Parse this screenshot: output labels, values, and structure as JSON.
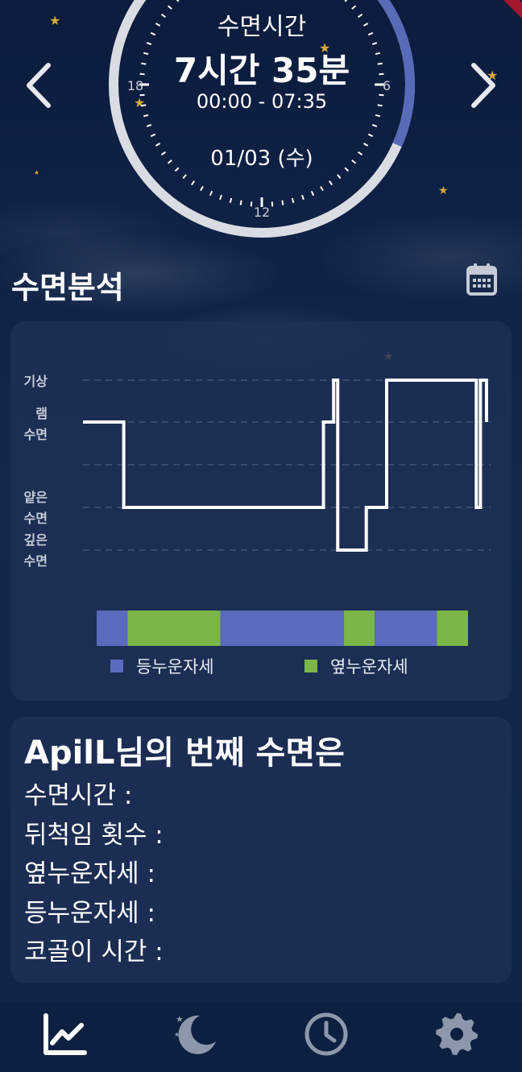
{
  "dial": {
    "title": "수면시간",
    "duration": "7시간 35분",
    "range": "00:00 - 07:35",
    "date": "01/03 (수)",
    "hour_labels": [
      "12",
      "18",
      "6"
    ],
    "accent_color": "#5a69b8",
    "ring_color": "#d9dce3"
  },
  "nav": {
    "prev_icon": "chevron-left-icon",
    "next_icon": "chevron-right-icon"
  },
  "analysis": {
    "title": "수면분석",
    "calendar_icon": "calendar-icon"
  },
  "chart_data": {
    "type": "line",
    "y_categories": [
      "기상",
      "램 수면",
      "얕은 수면",
      "깊은 수면"
    ],
    "y_label_lines": {
      "wake": "기상",
      "rem_1": "램",
      "rem_2": "수면",
      "light_1": "얕은",
      "light_2": "수면",
      "deep_1": "깊은",
      "deep_2": "수면"
    },
    "grid": "dashed",
    "stage_levels": {
      "wake": 4,
      "rem": 3,
      "light": 1,
      "deep": 0
    },
    "steps": [
      {
        "x": 0.0,
        "level": 3
      },
      {
        "x": 0.1,
        "level": 1
      },
      {
        "x": 0.59,
        "level": 3
      },
      {
        "x": 0.615,
        "level": 4
      },
      {
        "x": 0.625,
        "level": 0
      },
      {
        "x": 0.695,
        "level": 1
      },
      {
        "x": 0.745,
        "level": 4
      },
      {
        "x": 0.965,
        "level": 1
      },
      {
        "x": 0.975,
        "level": 4
      },
      {
        "x": 0.99,
        "level": 3
      }
    ],
    "x_end": 0.99,
    "posture": {
      "legend": [
        {
          "name": "등누운자세",
          "color": "#5b6abf"
        },
        {
          "name": "옆누운자세",
          "color": "#7ab648"
        }
      ],
      "segments": [
        {
          "value": 0.083,
          "posture": "back"
        },
        {
          "value": 0.25,
          "posture": "side"
        },
        {
          "value": 0.333,
          "posture": "back"
        },
        {
          "value": 0.083,
          "posture": "side"
        },
        {
          "value": 0.167,
          "posture": "back"
        },
        {
          "value": 0.084,
          "posture": "side"
        }
      ]
    }
  },
  "info": {
    "heading": "ApilL님의 번째 수면은",
    "rows": [
      "수면시간 :",
      "뒤척임 횟수 :",
      "옆누운자세 :",
      "등누운자세 :",
      "코골이 시간 :"
    ]
  },
  "bottom_nav": {
    "items": [
      "chart-line-icon",
      "moon-stars-icon",
      "clock-icon",
      "gear-icon"
    ],
    "active_color": "#ffffff",
    "inactive_color": "#8d97ab"
  }
}
